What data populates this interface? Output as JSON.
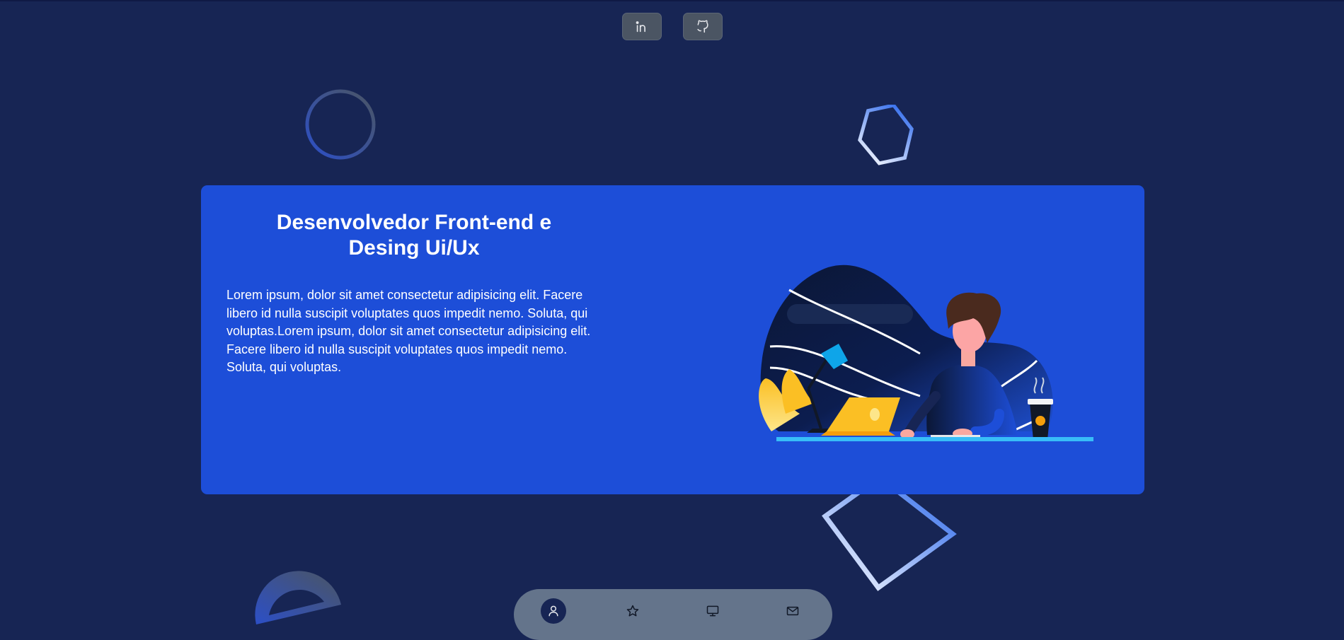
{
  "social": {
    "items": [
      {
        "name": "LinkedIn",
        "icon": "linkedin-icon"
      },
      {
        "name": "GitHub",
        "icon": "github-icon"
      }
    ]
  },
  "hero": {
    "title_line1": "Desenvolvedor Front-end e",
    "title_line2": "Desing Ui/Ux",
    "description": "Lorem ipsum, dolor sit amet consectetur adipisicing elit. Facere libero id nulla suscipit voluptates quos impedit nemo. Soluta, qui voluptas.Lorem ipsum, dolor sit amet consectetur adipisicing elit. Facere libero id nulla suscipit voluptates quos impedit nemo. Soluta, qui voluptas.",
    "illustration": "developer-at-laptop-illustration"
  },
  "bottom_nav": {
    "items": [
      {
        "icon": "user-icon",
        "active": true
      },
      {
        "icon": "star-icon",
        "active": false
      },
      {
        "icon": "monitor-icon",
        "active": false
      },
      {
        "icon": "mail-icon",
        "active": false
      }
    ]
  },
  "colors": {
    "background": "#172554",
    "card": "#1d4ed8",
    "social_button": "#4b5563",
    "bottom_nav": "#64748b",
    "active_nav": "#172554"
  }
}
